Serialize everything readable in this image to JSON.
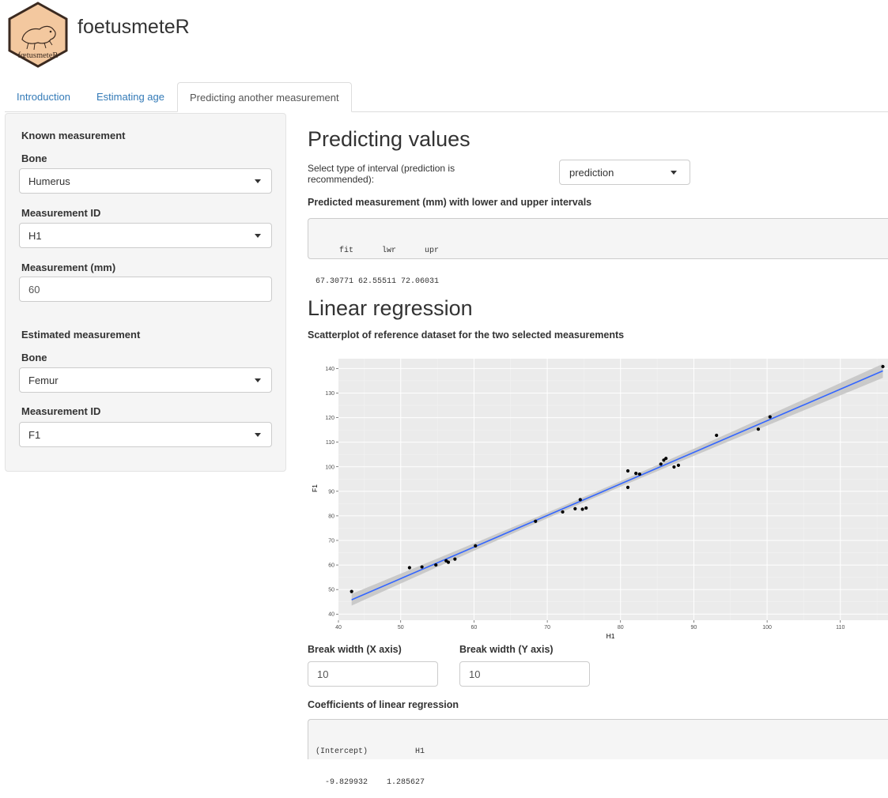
{
  "header": {
    "logo_text": "fœtusmeteR",
    "app_title": "foetusmeteR"
  },
  "tabs": [
    {
      "label": "Introduction",
      "active": false
    },
    {
      "label": "Estimating age",
      "active": false
    },
    {
      "label": "Predicting another measurement",
      "active": true
    }
  ],
  "sidebar": {
    "known": {
      "heading": "Known measurement",
      "bone_label": "Bone",
      "bone_value": "Humerus",
      "mid_label": "Measurement ID",
      "mid_value": "H1",
      "mm_label": "Measurement (mm)",
      "mm_value": "60"
    },
    "estimated": {
      "heading": "Estimated measurement",
      "bone_label": "Bone",
      "bone_value": "Femur",
      "mid_label": "Measurement ID",
      "mid_value": "F1"
    }
  },
  "main": {
    "predicting_title": "Predicting values",
    "interval_label": "Select type of interval (prediction is recommended):",
    "interval_value": "prediction",
    "predicted_label": "Predicted measurement (mm) with lower and upper intervals",
    "predicted_output": [
      "     fit      lwr      upr",
      "67.30771 62.55511 72.06031"
    ],
    "regression_title": "Linear regression",
    "scatter_label": "Scatterplot of reference dataset for the two selected measurements",
    "break_x_label": "Break width (X axis)",
    "break_x_value": "10",
    "break_y_label": "Break width (Y axis)",
    "break_y_value": "10",
    "coef_label": "Coefficients of linear regression",
    "coef_output": [
      "(Intercept)          H1",
      "  -9.829932    1.285627"
    ]
  },
  "colors": {
    "accent": "#337ab7",
    "panel_bg": "#ebebeb",
    "fit_line": "#3366ff",
    "ribbon": "#c3c3c3"
  },
  "chart_data": {
    "type": "scatter",
    "xlabel": "H1",
    "ylabel": "F1",
    "xlim": [
      41.5,
      116.5
    ],
    "ylim": [
      37.5,
      144
    ],
    "x_ticks": [
      40,
      50,
      60,
      70,
      80,
      90,
      100,
      110
    ],
    "y_ticks": [
      40,
      50,
      60,
      70,
      80,
      90,
      100,
      110,
      120,
      130,
      140
    ],
    "grid": true,
    "points": [
      [
        43.3,
        49.2
      ],
      [
        51.2,
        58.9
      ],
      [
        52.9,
        59.2
      ],
      [
        54.8,
        60.0
      ],
      [
        56.2,
        61.7
      ],
      [
        56.5,
        61.1
      ],
      [
        57.4,
        62.4
      ],
      [
        60.2,
        67.8
      ],
      [
        68.4,
        77.8
      ],
      [
        72.1,
        81.6
      ],
      [
        73.8,
        82.9
      ],
      [
        74.5,
        86.6
      ],
      [
        74.8,
        82.7
      ],
      [
        75.3,
        83.2
      ],
      [
        81.0,
        98.3
      ],
      [
        81.0,
        91.6
      ],
      [
        82.1,
        97.3
      ],
      [
        82.6,
        97.0
      ],
      [
        85.5,
        101.1
      ],
      [
        85.9,
        102.7
      ],
      [
        86.2,
        103.4
      ],
      [
        87.3,
        99.9
      ],
      [
        87.9,
        100.6
      ],
      [
        93.1,
        112.8
      ],
      [
        98.8,
        115.3
      ],
      [
        100.4,
        120.3
      ],
      [
        115.8,
        140.8
      ]
    ],
    "fit": {
      "intercept": -9.829932,
      "slope": 1.285627
    }
  }
}
